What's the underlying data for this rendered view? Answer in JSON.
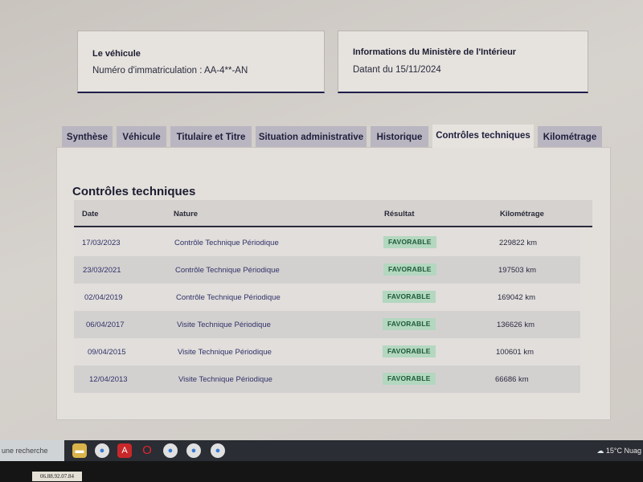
{
  "vehicle": {
    "title": "Le véhicule",
    "plate_line": "Numéro d'immatriculation : AA-4**-AN"
  },
  "ministry": {
    "title": "Informations du Ministère de l'Intérieur",
    "date_line": "Datant du 15/11/2024"
  },
  "tabs": [
    {
      "label": "Synthèse",
      "active": false
    },
    {
      "label": "Véhicule",
      "active": false
    },
    {
      "label": "Titulaire et Titre",
      "active": false
    },
    {
      "label": "Situation administrative",
      "active": false
    },
    {
      "label": "Historique",
      "active": false
    },
    {
      "label": "Contrôles techniques",
      "active": true
    },
    {
      "label": "Kilométrage",
      "active": false
    }
  ],
  "section": {
    "title": "Contrôles techniques"
  },
  "table": {
    "headers": [
      "Date",
      "Nature",
      "Résultat",
      "Kilométrage"
    ],
    "rows": [
      {
        "date": "17/03/2023",
        "nature": "Contrôle Technique Périodique",
        "result": "FAVORABLE",
        "km": "229822 km"
      },
      {
        "date": "23/03/2021",
        "nature": "Contrôle Technique Périodique",
        "result": "FAVORABLE",
        "km": "197503 km"
      },
      {
        "date": "02/04/2019",
        "nature": "Contrôle Technique Périodique",
        "result": "FAVORABLE",
        "km": "169042 km"
      },
      {
        "date": "06/04/2017",
        "nature": "Visite Technique Périodique",
        "result": "FAVORABLE",
        "km": "136626 km"
      },
      {
        "date": "09/04/2015",
        "nature": "Visite Technique Périodique",
        "result": "FAVORABLE",
        "km": "100601 km"
      },
      {
        "date": "12/04/2013",
        "nature": "Visite Technique Périodique",
        "result": "FAVORABLE",
        "km": "66686 km"
      }
    ]
  },
  "taskbar": {
    "search_text": "une recherche",
    "weather": "15°C  Nuag",
    "icons": [
      "file-explorer-icon",
      "chrome-icon",
      "acrobat-icon",
      "opera-icon",
      "chrome-icon",
      "chrome-icon",
      "chrome-icon"
    ]
  },
  "sticker": {
    "text": "06.88.92.07.84"
  },
  "colors": {
    "accent_dark": "#1e1e4a",
    "badge_bg": "#b3d7bf",
    "badge_text": "#1d5a3a",
    "tab_bg": "#b9b6c1"
  }
}
